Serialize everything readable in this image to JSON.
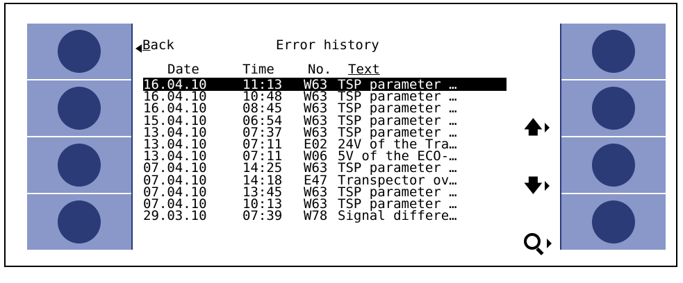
{
  "header": {
    "back_label_rest": "ack",
    "back_label_first": "B",
    "title": "Error history"
  },
  "columns": [
    "Date",
    "Time",
    "No.",
    "Text"
  ],
  "rows": [
    {
      "date": "16.04.10",
      "time": "11:13",
      "no": "W63",
      "text": "TSP parameter …",
      "selected": true
    },
    {
      "date": "16.04.10",
      "time": "10:48",
      "no": "W63",
      "text": "TSP parameter …",
      "selected": false
    },
    {
      "date": "16.04.10",
      "time": "08:45",
      "no": "W63",
      "text": "TSP parameter …",
      "selected": false
    },
    {
      "date": "15.04.10",
      "time": "06:54",
      "no": "W63",
      "text": "TSP parameter …",
      "selected": false
    },
    {
      "date": "13.04.10",
      "time": "07:37",
      "no": "W63",
      "text": "TSP parameter …",
      "selected": false
    },
    {
      "date": "13.04.10",
      "time": "07:11",
      "no": "E02",
      "text": "24V of the Tra…",
      "selected": false
    },
    {
      "date": "13.04.10",
      "time": "07:11",
      "no": "W06",
      "text": "5V of the ECO-…",
      "selected": false
    },
    {
      "date": "07.04.10",
      "time": "14:25",
      "no": "W63",
      "text": "TSP parameter …",
      "selected": false
    },
    {
      "date": "07.04.10",
      "time": "14:18",
      "no": "E47",
      "text": "Transpector ov…",
      "selected": false
    },
    {
      "date": "07.04.10",
      "time": "13:45",
      "no": "W63",
      "text": "TSP parameter …",
      "selected": false
    },
    {
      "date": "07.04.10",
      "time": "10:13",
      "no": "W63",
      "text": "TSP parameter …",
      "selected": false
    },
    {
      "date": "29.03.10",
      "time": "07:39",
      "no": "W78",
      "text": "Signal differe…",
      "selected": false
    }
  ],
  "nav": {
    "up_glyph": "🡅",
    "down_glyph": "🡇"
  },
  "colors": {
    "panel": "#8a97c9",
    "softkey": "#2b3b78",
    "selection": "#000000"
  }
}
